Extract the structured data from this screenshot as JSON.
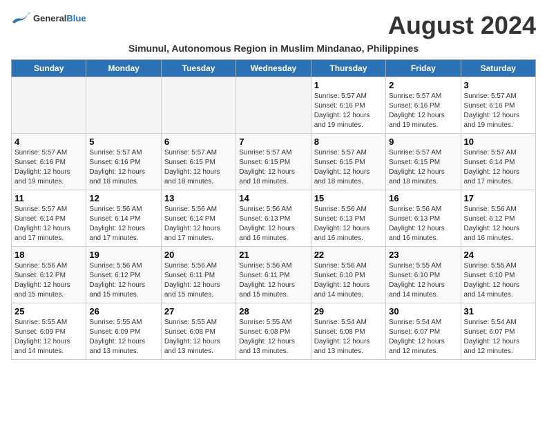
{
  "header": {
    "logo_general": "General",
    "logo_blue": "Blue",
    "title": "August 2024",
    "subtitle": "Simunul, Autonomous Region in Muslim Mindanao, Philippines"
  },
  "weekdays": [
    "Sunday",
    "Monday",
    "Tuesday",
    "Wednesday",
    "Thursday",
    "Friday",
    "Saturday"
  ],
  "weeks": [
    [
      {
        "day": "",
        "detail": ""
      },
      {
        "day": "",
        "detail": ""
      },
      {
        "day": "",
        "detail": ""
      },
      {
        "day": "",
        "detail": ""
      },
      {
        "day": "1",
        "detail": "Sunrise: 5:57 AM\nSunset: 6:16 PM\nDaylight: 12 hours\nand 19 minutes."
      },
      {
        "day": "2",
        "detail": "Sunrise: 5:57 AM\nSunset: 6:16 PM\nDaylight: 12 hours\nand 19 minutes."
      },
      {
        "day": "3",
        "detail": "Sunrise: 5:57 AM\nSunset: 6:16 PM\nDaylight: 12 hours\nand 19 minutes."
      }
    ],
    [
      {
        "day": "4",
        "detail": "Sunrise: 5:57 AM\nSunset: 6:16 PM\nDaylight: 12 hours\nand 19 minutes."
      },
      {
        "day": "5",
        "detail": "Sunrise: 5:57 AM\nSunset: 6:16 PM\nDaylight: 12 hours\nand 18 minutes."
      },
      {
        "day": "6",
        "detail": "Sunrise: 5:57 AM\nSunset: 6:15 PM\nDaylight: 12 hours\nand 18 minutes."
      },
      {
        "day": "7",
        "detail": "Sunrise: 5:57 AM\nSunset: 6:15 PM\nDaylight: 12 hours\nand 18 minutes."
      },
      {
        "day": "8",
        "detail": "Sunrise: 5:57 AM\nSunset: 6:15 PM\nDaylight: 12 hours\nand 18 minutes."
      },
      {
        "day": "9",
        "detail": "Sunrise: 5:57 AM\nSunset: 6:15 PM\nDaylight: 12 hours\nand 18 minutes."
      },
      {
        "day": "10",
        "detail": "Sunrise: 5:57 AM\nSunset: 6:14 PM\nDaylight: 12 hours\nand 17 minutes."
      }
    ],
    [
      {
        "day": "11",
        "detail": "Sunrise: 5:57 AM\nSunset: 6:14 PM\nDaylight: 12 hours\nand 17 minutes."
      },
      {
        "day": "12",
        "detail": "Sunrise: 5:56 AM\nSunset: 6:14 PM\nDaylight: 12 hours\nand 17 minutes."
      },
      {
        "day": "13",
        "detail": "Sunrise: 5:56 AM\nSunset: 6:14 PM\nDaylight: 12 hours\nand 17 minutes."
      },
      {
        "day": "14",
        "detail": "Sunrise: 5:56 AM\nSunset: 6:13 PM\nDaylight: 12 hours\nand 16 minutes."
      },
      {
        "day": "15",
        "detail": "Sunrise: 5:56 AM\nSunset: 6:13 PM\nDaylight: 12 hours\nand 16 minutes."
      },
      {
        "day": "16",
        "detail": "Sunrise: 5:56 AM\nSunset: 6:13 PM\nDaylight: 12 hours\nand 16 minutes."
      },
      {
        "day": "17",
        "detail": "Sunrise: 5:56 AM\nSunset: 6:12 PM\nDaylight: 12 hours\nand 16 minutes."
      }
    ],
    [
      {
        "day": "18",
        "detail": "Sunrise: 5:56 AM\nSunset: 6:12 PM\nDaylight: 12 hours\nand 15 minutes."
      },
      {
        "day": "19",
        "detail": "Sunrise: 5:56 AM\nSunset: 6:12 PM\nDaylight: 12 hours\nand 15 minutes."
      },
      {
        "day": "20",
        "detail": "Sunrise: 5:56 AM\nSunset: 6:11 PM\nDaylight: 12 hours\nand 15 minutes."
      },
      {
        "day": "21",
        "detail": "Sunrise: 5:56 AM\nSunset: 6:11 PM\nDaylight: 12 hours\nand 15 minutes."
      },
      {
        "day": "22",
        "detail": "Sunrise: 5:56 AM\nSunset: 6:10 PM\nDaylight: 12 hours\nand 14 minutes."
      },
      {
        "day": "23",
        "detail": "Sunrise: 5:55 AM\nSunset: 6:10 PM\nDaylight: 12 hours\nand 14 minutes."
      },
      {
        "day": "24",
        "detail": "Sunrise: 5:55 AM\nSunset: 6:10 PM\nDaylight: 12 hours\nand 14 minutes."
      }
    ],
    [
      {
        "day": "25",
        "detail": "Sunrise: 5:55 AM\nSunset: 6:09 PM\nDaylight: 12 hours\nand 14 minutes."
      },
      {
        "day": "26",
        "detail": "Sunrise: 5:55 AM\nSunset: 6:09 PM\nDaylight: 12 hours\nand 13 minutes."
      },
      {
        "day": "27",
        "detail": "Sunrise: 5:55 AM\nSunset: 6:08 PM\nDaylight: 12 hours\nand 13 minutes."
      },
      {
        "day": "28",
        "detail": "Sunrise: 5:55 AM\nSunset: 6:08 PM\nDaylight: 12 hours\nand 13 minutes."
      },
      {
        "day": "29",
        "detail": "Sunrise: 5:54 AM\nSunset: 6:08 PM\nDaylight: 12 hours\nand 13 minutes."
      },
      {
        "day": "30",
        "detail": "Sunrise: 5:54 AM\nSunset: 6:07 PM\nDaylight: 12 hours\nand 12 minutes."
      },
      {
        "day": "31",
        "detail": "Sunrise: 5:54 AM\nSunset: 6:07 PM\nDaylight: 12 hours\nand 12 minutes."
      }
    ]
  ]
}
